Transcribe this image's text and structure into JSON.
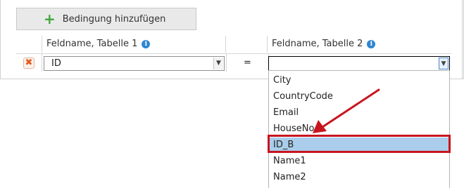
{
  "toolbar": {
    "add_condition_label": "Bedingung hinzufügen"
  },
  "table": {
    "col1_header": "Feldname, Tabelle 1",
    "col2_header": "Feldname, Tabelle 2",
    "info_icon_glyph": "i",
    "row": {
      "field1_value": "ID",
      "operator": "=",
      "field2_value": ""
    }
  },
  "dropdown": {
    "options": [
      "City",
      "CountryCode",
      "Email",
      "HouseNo",
      "ID_B",
      "Name1",
      "Name2"
    ],
    "highlighted_option": "ID_B"
  },
  "annotation": {
    "color": "#c8141e"
  },
  "icons": {
    "add": "plus-icon",
    "delete": "delete-x-icon",
    "info": "info-icon",
    "dropdown": "chevron-down-icon"
  }
}
